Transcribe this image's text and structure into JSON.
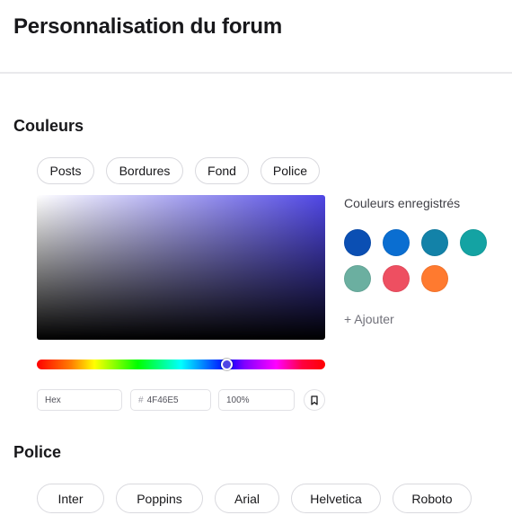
{
  "page": {
    "title": "Personnalisation du forum"
  },
  "colors": {
    "section_title": "Couleurs",
    "tabs": [
      {
        "label": "Posts"
      },
      {
        "label": "Bordures"
      },
      {
        "label": "Fond"
      },
      {
        "label": "Police"
      }
    ],
    "picker": {
      "base_color": "#4F46E5",
      "hex_placeholder": "Hex",
      "hex_value": "4F46E5",
      "hash_symbol": "#",
      "opacity": "100%"
    },
    "saved": {
      "title": "Couleurs enregistrés",
      "swatches": [
        "#0B4FB3",
        "#0A6ED1",
        "#1382A8",
        "#14A3A3",
        "#6BAFA0",
        "#EE4F61",
        "#FF7A2F"
      ],
      "add_label": "+ Ajouter"
    }
  },
  "fonts": {
    "section_title": "Police",
    "options": [
      {
        "label": "Inter"
      },
      {
        "label": "Poppins"
      },
      {
        "label": "Arial"
      },
      {
        "label": "Helvetica"
      },
      {
        "label": "Roboto"
      }
    ]
  }
}
